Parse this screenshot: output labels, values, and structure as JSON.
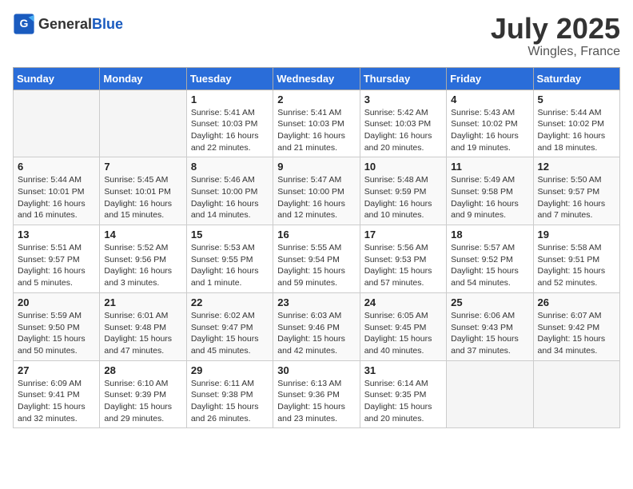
{
  "header": {
    "logo_general": "General",
    "logo_blue": "Blue",
    "month": "July 2025",
    "location": "Wingles, France"
  },
  "days_of_week": [
    "Sunday",
    "Monday",
    "Tuesday",
    "Wednesday",
    "Thursday",
    "Friday",
    "Saturday"
  ],
  "weeks": [
    [
      {
        "num": "",
        "info": ""
      },
      {
        "num": "",
        "info": ""
      },
      {
        "num": "1",
        "info": "Sunrise: 5:41 AM\nSunset: 10:03 PM\nDaylight: 16 hours and 22 minutes."
      },
      {
        "num": "2",
        "info": "Sunrise: 5:41 AM\nSunset: 10:03 PM\nDaylight: 16 hours and 21 minutes."
      },
      {
        "num": "3",
        "info": "Sunrise: 5:42 AM\nSunset: 10:03 PM\nDaylight: 16 hours and 20 minutes."
      },
      {
        "num": "4",
        "info": "Sunrise: 5:43 AM\nSunset: 10:02 PM\nDaylight: 16 hours and 19 minutes."
      },
      {
        "num": "5",
        "info": "Sunrise: 5:44 AM\nSunset: 10:02 PM\nDaylight: 16 hours and 18 minutes."
      }
    ],
    [
      {
        "num": "6",
        "info": "Sunrise: 5:44 AM\nSunset: 10:01 PM\nDaylight: 16 hours and 16 minutes."
      },
      {
        "num": "7",
        "info": "Sunrise: 5:45 AM\nSunset: 10:01 PM\nDaylight: 16 hours and 15 minutes."
      },
      {
        "num": "8",
        "info": "Sunrise: 5:46 AM\nSunset: 10:00 PM\nDaylight: 16 hours and 14 minutes."
      },
      {
        "num": "9",
        "info": "Sunrise: 5:47 AM\nSunset: 10:00 PM\nDaylight: 16 hours and 12 minutes."
      },
      {
        "num": "10",
        "info": "Sunrise: 5:48 AM\nSunset: 9:59 PM\nDaylight: 16 hours and 10 minutes."
      },
      {
        "num": "11",
        "info": "Sunrise: 5:49 AM\nSunset: 9:58 PM\nDaylight: 16 hours and 9 minutes."
      },
      {
        "num": "12",
        "info": "Sunrise: 5:50 AM\nSunset: 9:57 PM\nDaylight: 16 hours and 7 minutes."
      }
    ],
    [
      {
        "num": "13",
        "info": "Sunrise: 5:51 AM\nSunset: 9:57 PM\nDaylight: 16 hours and 5 minutes."
      },
      {
        "num": "14",
        "info": "Sunrise: 5:52 AM\nSunset: 9:56 PM\nDaylight: 16 hours and 3 minutes."
      },
      {
        "num": "15",
        "info": "Sunrise: 5:53 AM\nSunset: 9:55 PM\nDaylight: 16 hours and 1 minute."
      },
      {
        "num": "16",
        "info": "Sunrise: 5:55 AM\nSunset: 9:54 PM\nDaylight: 15 hours and 59 minutes."
      },
      {
        "num": "17",
        "info": "Sunrise: 5:56 AM\nSunset: 9:53 PM\nDaylight: 15 hours and 57 minutes."
      },
      {
        "num": "18",
        "info": "Sunrise: 5:57 AM\nSunset: 9:52 PM\nDaylight: 15 hours and 54 minutes."
      },
      {
        "num": "19",
        "info": "Sunrise: 5:58 AM\nSunset: 9:51 PM\nDaylight: 15 hours and 52 minutes."
      }
    ],
    [
      {
        "num": "20",
        "info": "Sunrise: 5:59 AM\nSunset: 9:50 PM\nDaylight: 15 hours and 50 minutes."
      },
      {
        "num": "21",
        "info": "Sunrise: 6:01 AM\nSunset: 9:48 PM\nDaylight: 15 hours and 47 minutes."
      },
      {
        "num": "22",
        "info": "Sunrise: 6:02 AM\nSunset: 9:47 PM\nDaylight: 15 hours and 45 minutes."
      },
      {
        "num": "23",
        "info": "Sunrise: 6:03 AM\nSunset: 9:46 PM\nDaylight: 15 hours and 42 minutes."
      },
      {
        "num": "24",
        "info": "Sunrise: 6:05 AM\nSunset: 9:45 PM\nDaylight: 15 hours and 40 minutes."
      },
      {
        "num": "25",
        "info": "Sunrise: 6:06 AM\nSunset: 9:43 PM\nDaylight: 15 hours and 37 minutes."
      },
      {
        "num": "26",
        "info": "Sunrise: 6:07 AM\nSunset: 9:42 PM\nDaylight: 15 hours and 34 minutes."
      }
    ],
    [
      {
        "num": "27",
        "info": "Sunrise: 6:09 AM\nSunset: 9:41 PM\nDaylight: 15 hours and 32 minutes."
      },
      {
        "num": "28",
        "info": "Sunrise: 6:10 AM\nSunset: 9:39 PM\nDaylight: 15 hours and 29 minutes."
      },
      {
        "num": "29",
        "info": "Sunrise: 6:11 AM\nSunset: 9:38 PM\nDaylight: 15 hours and 26 minutes."
      },
      {
        "num": "30",
        "info": "Sunrise: 6:13 AM\nSunset: 9:36 PM\nDaylight: 15 hours and 23 minutes."
      },
      {
        "num": "31",
        "info": "Sunrise: 6:14 AM\nSunset: 9:35 PM\nDaylight: 15 hours and 20 minutes."
      },
      {
        "num": "",
        "info": ""
      },
      {
        "num": "",
        "info": ""
      }
    ]
  ]
}
